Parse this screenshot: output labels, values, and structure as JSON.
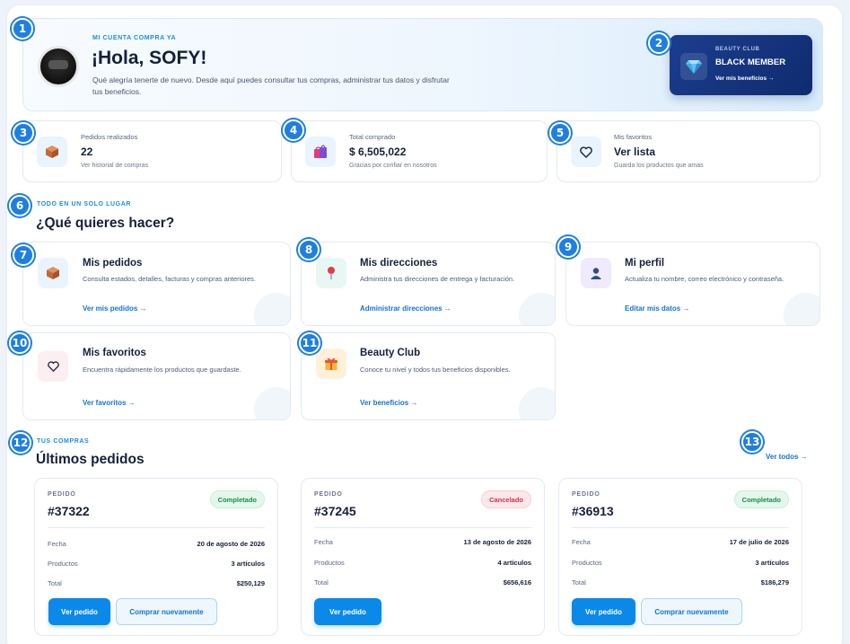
{
  "hero": {
    "eyebrow": "MI CUENTA COMPRA YA",
    "title": "¡Hola, SOFY!",
    "subtitle": "Qué alegría tenerte de nuevo. Desde aquí puedes consultar tus compras, administrar tus datos y disfrutar tus beneficios."
  },
  "member": {
    "eyebrow": "BEAUTY CLUB",
    "level": "BLACK MEMBER",
    "link": "Ver mis beneficios →",
    "icon": "diamond-icon"
  },
  "stats": [
    {
      "label": "Pedidos realizados",
      "value": "22",
      "hint": "Ver historial de compras",
      "icon": "box-icon"
    },
    {
      "label": "Total comprado",
      "value": "$ 6,505,022",
      "hint": "Gracias por confiar en nosotros",
      "icon": "shopping-bags-icon"
    },
    {
      "label": "Mis favoritos",
      "value": "Ver lista",
      "hint": "Guarda los productos que amas",
      "icon": "heart-icon"
    }
  ],
  "actions_section": {
    "eyebrow": "TODO EN UN SOLO LUGAR",
    "title": "¿Qué quieres hacer?"
  },
  "actions": [
    {
      "title": "Mis pedidos",
      "desc": "Consulta estados, detalles, facturas y compras anteriores.",
      "link": "Ver mis pedidos →",
      "icon": "box-icon"
    },
    {
      "title": "Mis direcciones",
      "desc": "Administra tus direcciones de entrega y facturación.",
      "link": "Administrar direcciones →",
      "icon": "pin-icon"
    },
    {
      "title": "Mi perfil",
      "desc": "Actualiza tu nombre, correo electrónico y contraseña.",
      "link": "Editar mis datos →",
      "icon": "user-icon"
    },
    {
      "title": "Mis favoritos",
      "desc": "Encuentra rápidamente los productos que guardaste.",
      "link": "Ver favoritos →",
      "icon": "heart-icon"
    },
    {
      "title": "Beauty Club",
      "desc": "Conoce tu nivel y todos tus beneficios disponibles.",
      "link": "Ver beneficios →",
      "icon": "gift-icon"
    }
  ],
  "orders_section": {
    "eyebrow": "TUS COMPRAS",
    "title": "Últimos pedidos",
    "view_all": "Ver todos →"
  },
  "orders": [
    {
      "label": "PEDIDO",
      "number": "#37322",
      "status": "Completado",
      "fecha_k": "Fecha",
      "fecha": "20 de agosto de 2026",
      "productos_k": "Productos",
      "productos": "3 artículos",
      "total_k": "Total",
      "total": "$250,129",
      "view": "Ver pedido",
      "rebuy": "Comprar nuevamente"
    },
    {
      "label": "PEDIDO",
      "number": "#37245",
      "status": "Cancelado",
      "fecha_k": "Fecha",
      "fecha": "13 de agosto de 2026",
      "productos_k": "Productos",
      "productos": "4 artículos",
      "total_k": "Total",
      "total": "$656,616",
      "view": "Ver pedido"
    },
    {
      "label": "PEDIDO",
      "number": "#36913",
      "status": "Completado",
      "fecha_k": "Fecha",
      "fecha": "17 de julio de 2026",
      "productos_k": "Productos",
      "productos": "3 artículos",
      "total_k": "Total",
      "total": "$186,279",
      "view": "Ver pedido",
      "rebuy": "Comprar nuevamente"
    }
  ],
  "markers": [
    "1",
    "2",
    "3",
    "4",
    "5",
    "6",
    "7",
    "8",
    "9",
    "10",
    "11",
    "12",
    "13"
  ],
  "colors": {
    "accent": "#0a89e8",
    "member_bg": "#0f2b6e",
    "success": "#1c8a4c",
    "danger": "#cf3347"
  }
}
